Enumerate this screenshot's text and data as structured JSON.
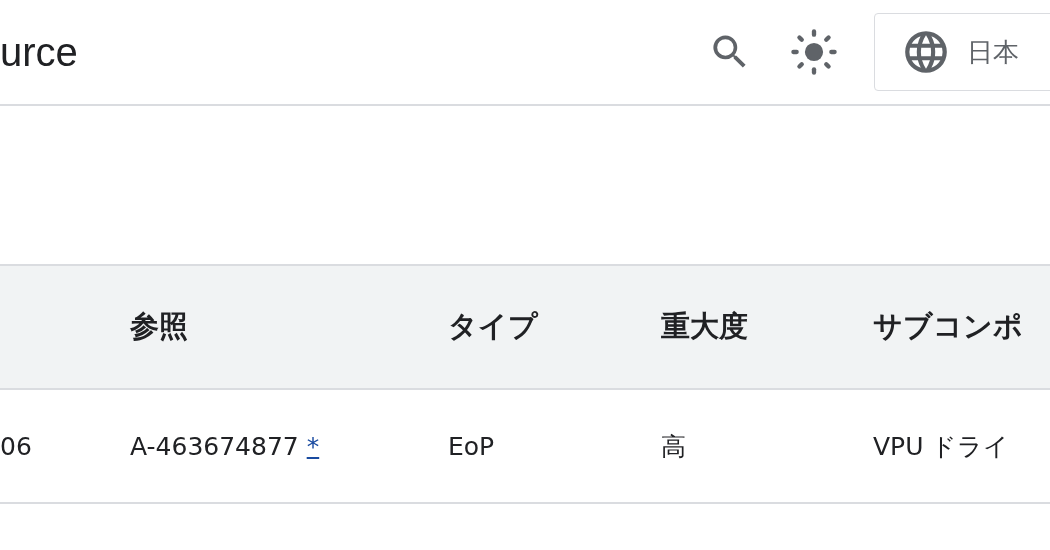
{
  "header": {
    "title": "urce",
    "language_button": {
      "label": "日本"
    }
  },
  "table": {
    "columns": [
      "",
      "参照",
      "タイプ",
      "重大度",
      "サブコンポ"
    ],
    "rows": [
      {
        "column_1": "06",
        "reference": "A-463674877",
        "reference_link": "*",
        "type": "EoP",
        "severity": "高",
        "subcomponent": "VPU ドライ"
      }
    ]
  }
}
